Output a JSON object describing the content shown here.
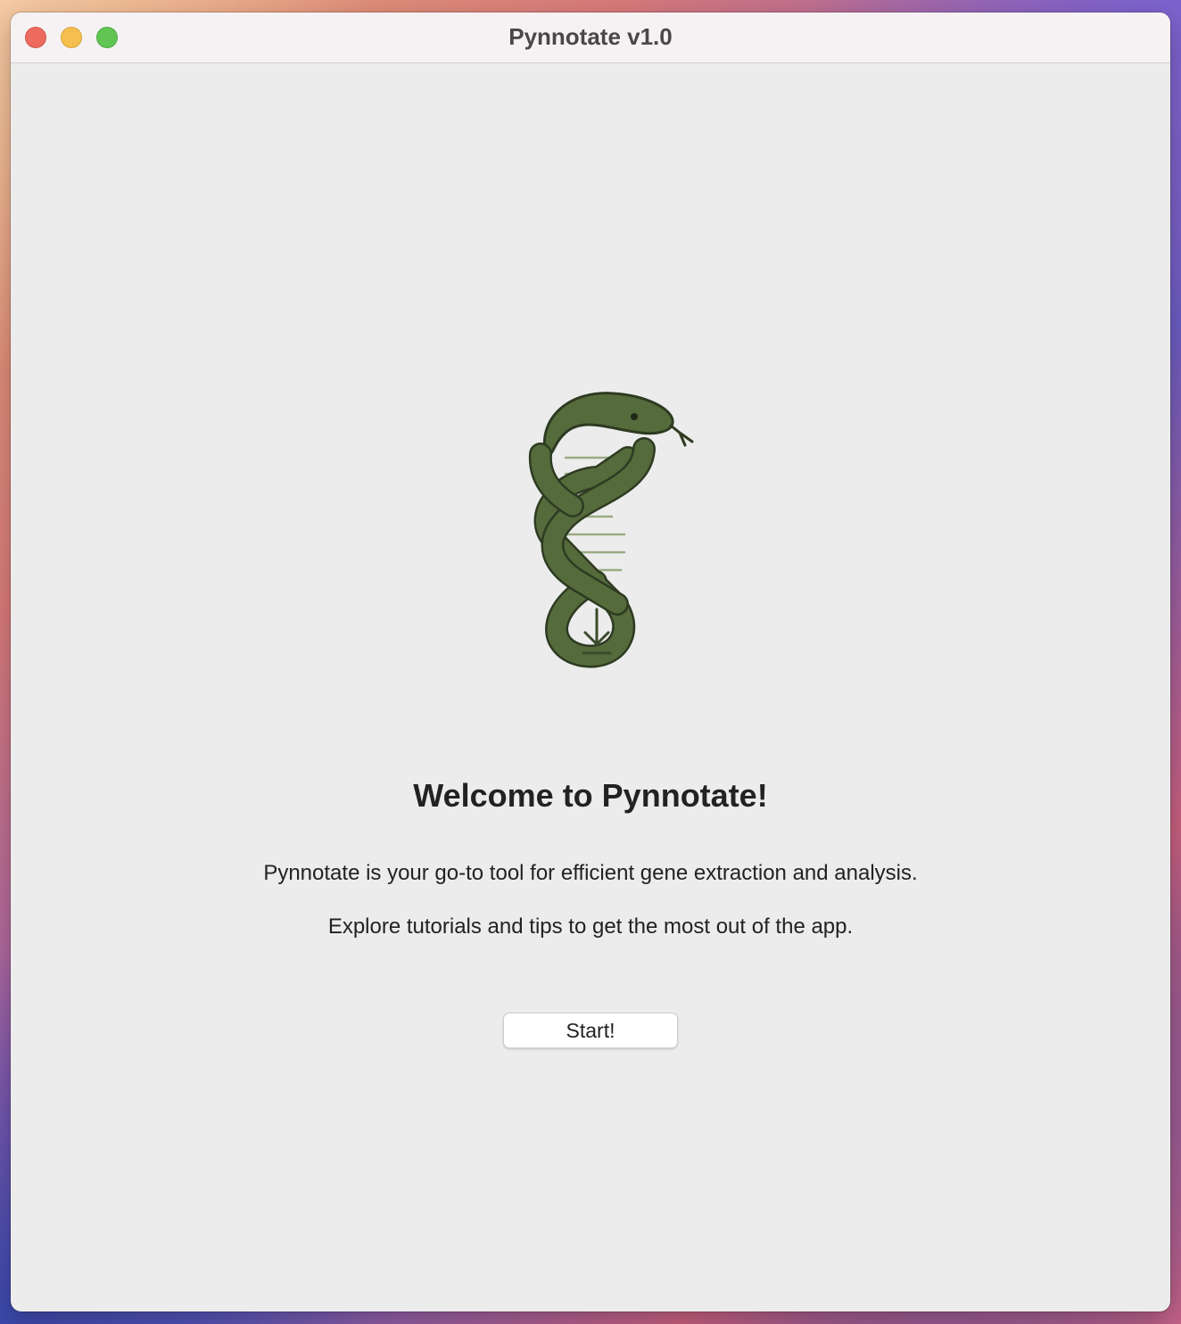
{
  "window": {
    "title": "Pynnotate v1.0",
    "controls": [
      "close",
      "minimize",
      "zoom"
    ]
  },
  "welcome": {
    "logo_icon": "snake-dna-download-icon",
    "heading": "Welcome to Pynnotate!",
    "description_1": "Pynnotate is your go-to tool for efficient gene extraction and analysis.",
    "description_2": "Explore tutorials and tips to get the most out of the app.",
    "start_label": "Start!"
  },
  "colors": {
    "logo_green": "#556b3c",
    "logo_outline": "#2e3b22",
    "rung_green": "#9aab82"
  }
}
